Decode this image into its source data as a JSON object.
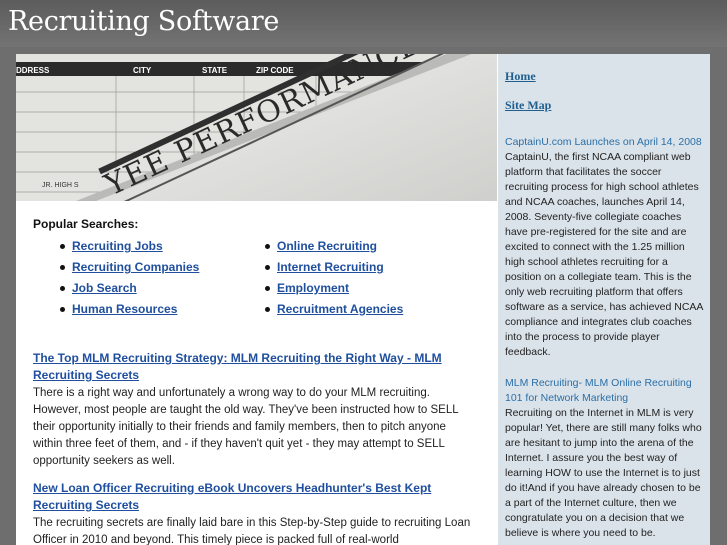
{
  "site": {
    "title": "Recruiting Software"
  },
  "hero": {
    "form_headers": [
      "DDRESS",
      "CITY",
      "STATE",
      "ZIP CODE"
    ],
    "form_footer": "JR. HIGH S",
    "document_title": "YEE PERFORMANCE EVALUATIO"
  },
  "popular": {
    "heading": "Popular Searches:",
    "left": [
      "Recruiting Jobs",
      "Recruiting Companies",
      "Job Search",
      "Human Resources"
    ],
    "right": [
      "Online Recruiting",
      "Internet Recruiting",
      "Employment",
      "Recruitment Agencies"
    ]
  },
  "articles": [
    {
      "title": "The Top MLM Recruiting Strategy: MLM Recruiting the Right Way - MLM Recruiting Secrets",
      "body": "There is a right way and unfortunately a wrong way to do your MLM recruiting. However, most people are taught the old way. They've been instructed how to SELL their opportunity initially to their friends and family members, then to pitch anyone within three feet of them, and - if they haven't quit yet - they may attempt to SELL opportunity seekers as well."
    },
    {
      "title": "New Loan Officer Recruiting eBook Uncovers Headhunter's Best Kept Recruiting Secrets",
      "body": "The recruiting secrets are finally laid bare in this Step-by-Step guide to recruiting Loan Officer in 2010 and beyond. This timely piece is packed full of real-world"
    }
  ],
  "sidebar": {
    "links": [
      "Home",
      "Site Map"
    ],
    "articles": [
      {
        "title": "CaptainU.com Launches on April 14, 2008",
        "body": "CaptainU, the first NCAA compliant web platform that facilitates the soccer recruiting process for high school athletes and NCAA coaches, launches April 14, 2008. Seventy-five collegiate coaches have pre-registered for the site and are excited to connect with the 1.25 million high school athletes recruiting for a position on a collegiate team. This is the only web recruiting platform that offers software as a service, has achieved NCAA compliance and integrates club coaches into the process to provide player feedback."
      },
      {
        "title": "MLM Recruiting- MLM Online Recruiting 101 for Network Marketing",
        "body": "Recruiting on the Internet in MLM is very popular! Yet, there are still many folks who are hesitant to jump into the arena of the Internet. I assure you the best way of learning HOW to use the Internet is to just do it!And if you have already chosen to be a part of the Internet culture, then we congratulate you on a decision that we believe is where you need to be."
      }
    ]
  }
}
